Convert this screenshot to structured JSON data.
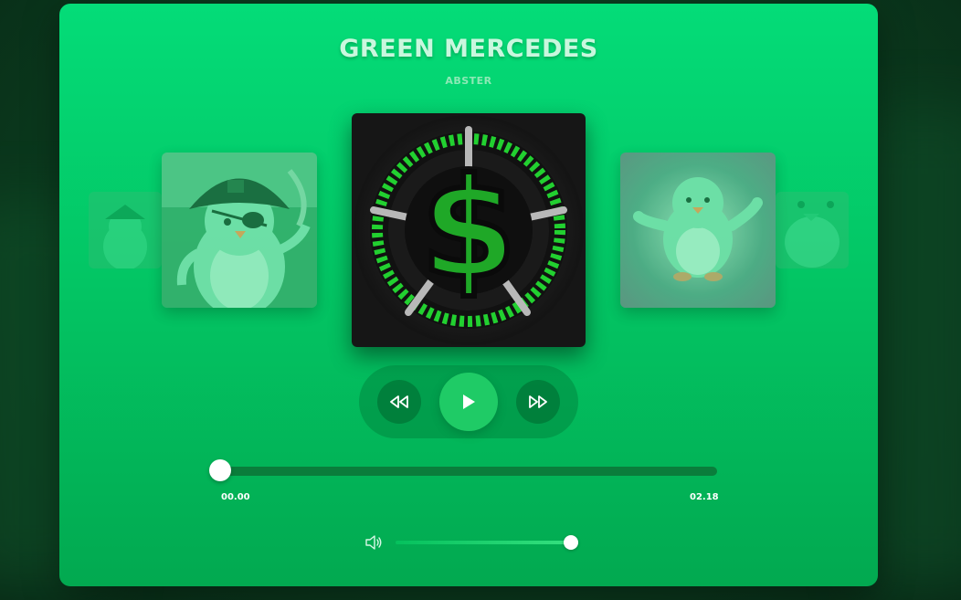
{
  "track": {
    "title": "GREEN MERCEDES",
    "artist": "ABSTER"
  },
  "covers": [
    {
      "name": "far-left-cover",
      "icon": "pirate-penguin-art"
    },
    {
      "name": "left-cover",
      "icon": "pirate-penguin-art"
    },
    {
      "name": "center-cover",
      "icon": "dollar-sign-wheel-art"
    },
    {
      "name": "right-cover",
      "icon": "flying-penguin-art"
    },
    {
      "name": "far-right-cover",
      "icon": "penguin-art"
    }
  ],
  "controls": {
    "prev_icon": "rewind-icon",
    "play_icon": "play-icon",
    "next_icon": "fast-forward-icon"
  },
  "progress": {
    "current": "00.00",
    "total": "02.18",
    "fraction": 0.0
  },
  "volume": {
    "icon": "speaker-icon",
    "level": 1.0
  },
  "colors": {
    "accent": "#04dc78",
    "play_button": "#1fcb66",
    "track": "#0a7d3b"
  }
}
